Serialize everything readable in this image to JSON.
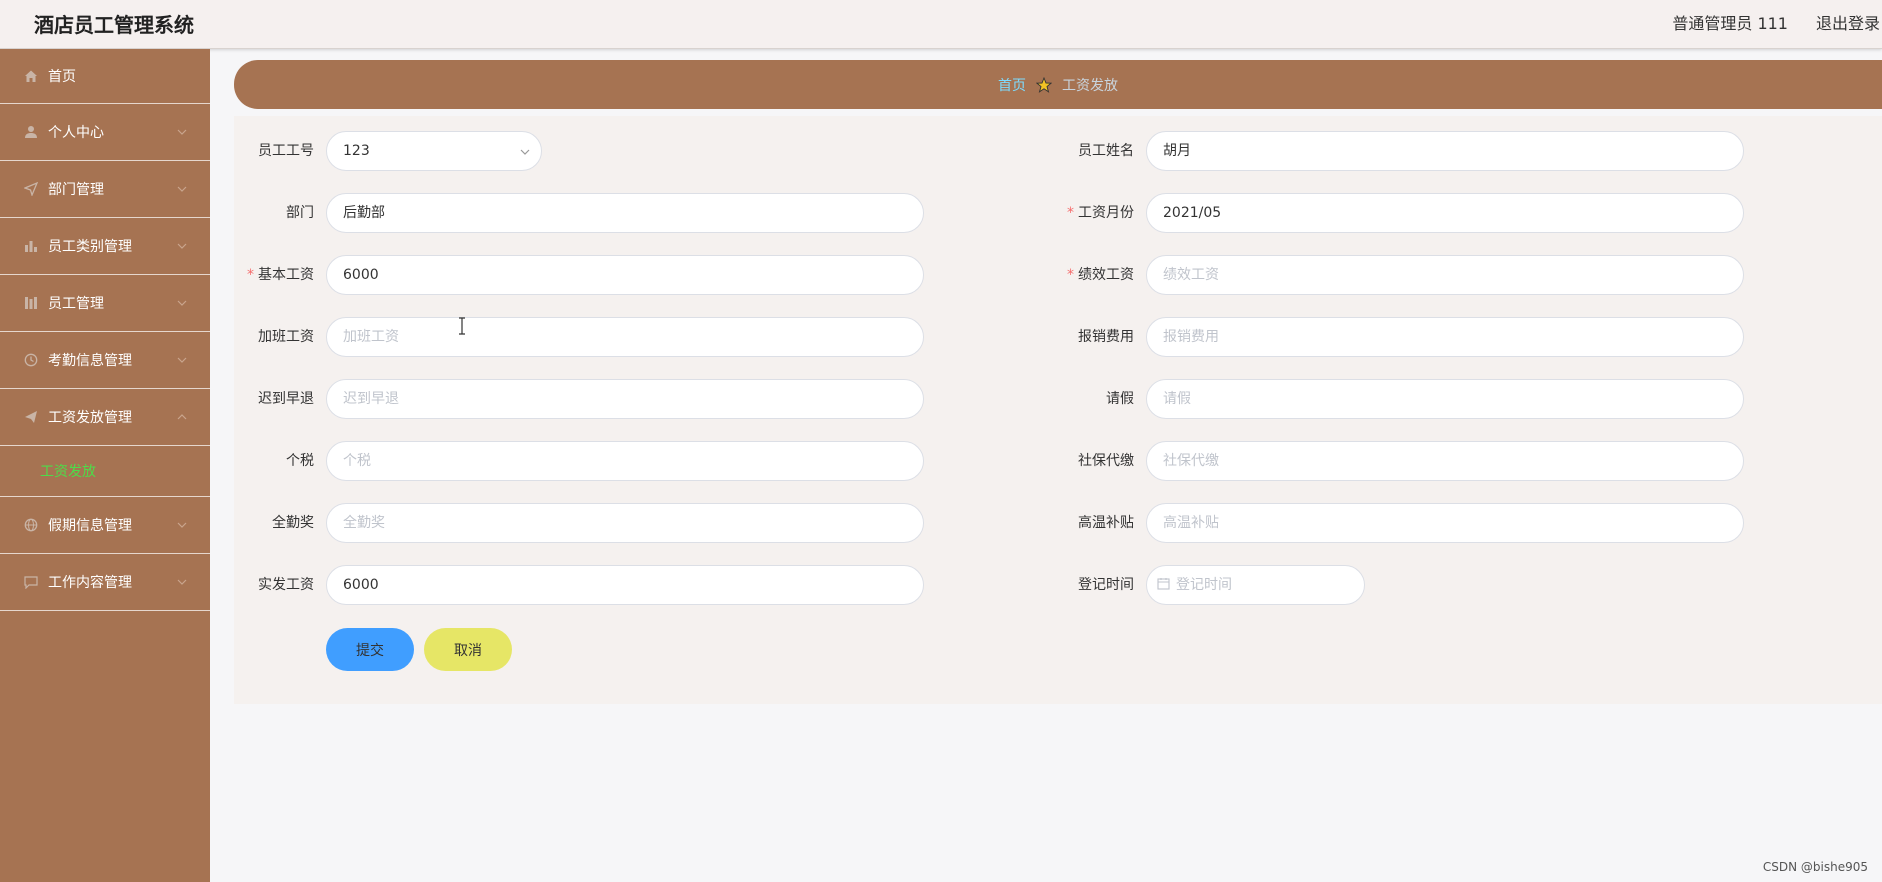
{
  "header": {
    "app_title": "酒店员工管理系统",
    "user_label": "普通管理员 111",
    "logout_label": "退出登录"
  },
  "sidebar": {
    "items": [
      {
        "label": "首页",
        "icon": "home-icon"
      },
      {
        "label": "个人中心",
        "icon": "user-icon"
      },
      {
        "label": "部门管理",
        "icon": "send-icon"
      },
      {
        "label": "员工类别管理",
        "icon": "bar-chart-icon"
      },
      {
        "label": "员工管理",
        "icon": "columns-icon"
      },
      {
        "label": "考勤信息管理",
        "icon": "clock-icon"
      },
      {
        "label": "工资发放管理",
        "icon": "plane-icon"
      },
      {
        "label": "假期信息管理",
        "icon": "globe-icon"
      },
      {
        "label": "工作内容管理",
        "icon": "chat-icon"
      }
    ],
    "active_sub": "工资发放"
  },
  "breadcrumb": {
    "home": "首页",
    "current": "工资发放"
  },
  "form": {
    "employee_no": {
      "label": "员工工号",
      "value": "123"
    },
    "employee_name": {
      "label": "员工姓名",
      "value": "胡月"
    },
    "department": {
      "label": "部门",
      "value": "后勤部"
    },
    "pay_month": {
      "label": "工资月份",
      "value": "2021/05"
    },
    "base_salary": {
      "label": "基本工资",
      "value": "6000"
    },
    "performance_pay": {
      "label": "绩效工资",
      "placeholder": "绩效工资"
    },
    "overtime_pay": {
      "label": "加班工资",
      "placeholder": "加班工资"
    },
    "reimbursement": {
      "label": "报销费用",
      "placeholder": "报销费用"
    },
    "late_early": {
      "label": "迟到早退",
      "placeholder": "迟到早退"
    },
    "leave": {
      "label": "请假",
      "placeholder": "请假"
    },
    "income_tax": {
      "label": "个税",
      "placeholder": "个税"
    },
    "social_security": {
      "label": "社保代缴",
      "placeholder": "社保代缴"
    },
    "attendance_bonus": {
      "label": "全勤奖",
      "placeholder": "全勤奖"
    },
    "heat_allowance": {
      "label": "高温补贴",
      "placeholder": "高温补贴"
    },
    "net_pay": {
      "label": "实发工资",
      "value": "6000"
    },
    "register_time": {
      "label": "登记时间",
      "placeholder": "登记时间"
    },
    "submit_label": "提交",
    "cancel_label": "取消"
  },
  "watermark": "CSDN @bishe905",
  "colors": {
    "sidebar_bg": "#a67352",
    "active_sub": "#4ddc49",
    "breadcrumb_home": "#7ddcff",
    "submit_bg": "#409eff",
    "cancel_bg": "#e6e666",
    "required": "#f56c6c"
  }
}
